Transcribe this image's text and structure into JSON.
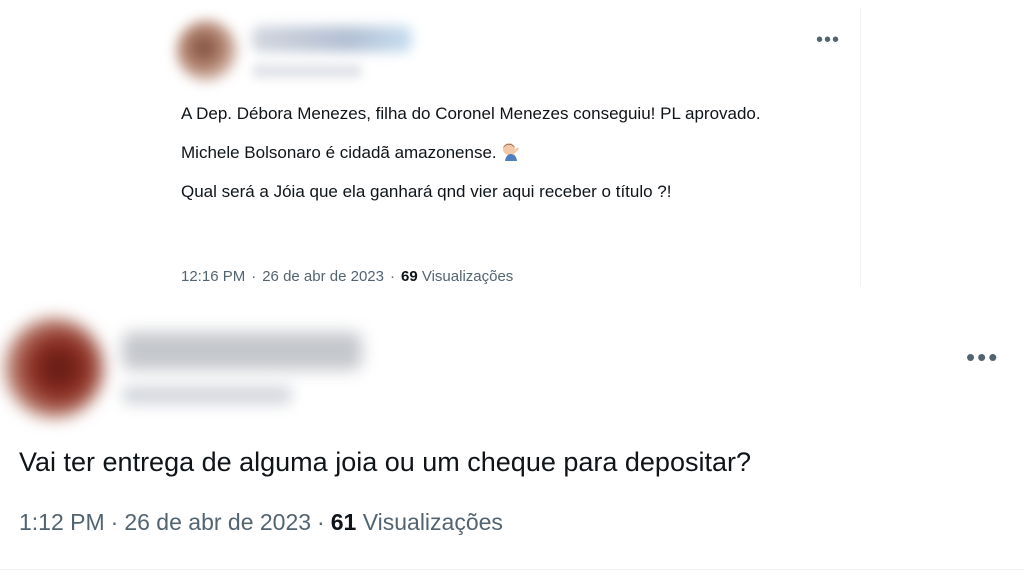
{
  "tweet1": {
    "more_icon": "•••",
    "paragraphs": [
      "A Dep. Débora Menezes, filha do Coronel Menezes conseguiu! PL aprovado.",
      "Michele Bolsonaro é cidadã amazonense.",
      "Qual será a Jóia que ela ganhará qnd vier aqui receber o título ?!"
    ],
    "emoji_icon": "person-facepalming-icon",
    "time": "12:16 PM",
    "date": "26 de abr de 2023",
    "views_count": "69",
    "views_label": "Visualizações"
  },
  "tweet2": {
    "more_icon": "•••",
    "text": "Vai ter entrega de alguma joia ou um cheque para depositar?",
    "time": "1:12 PM",
    "date": "26 de abr de 2023",
    "views_count": "61",
    "views_label": "Visualizações"
  },
  "colors": {
    "text_primary": "#0f1419",
    "text_secondary": "#536471",
    "border": "#eff3f4"
  }
}
